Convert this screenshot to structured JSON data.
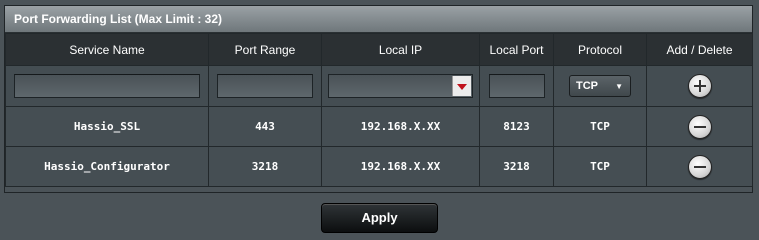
{
  "panel": {
    "title": "Port Forwarding List (Max Limit : 32)"
  },
  "table": {
    "headers": [
      "Service Name",
      "Port Range",
      "Local IP",
      "Local Port",
      "Protocol",
      "Add / Delete"
    ],
    "new_entry": {
      "service_name": "",
      "port_range": "",
      "local_ip": "",
      "local_port": "",
      "protocol": "TCP",
      "add_icon": "plus-circle-icon"
    },
    "rows": [
      {
        "service_name": "Hassio_SSL",
        "port_range": "443",
        "local_ip": "192.168.X.XX",
        "local_port": "8123",
        "protocol": "TCP",
        "delete_icon": "minus-circle-icon"
      },
      {
        "service_name": "Hassio_Configurator",
        "port_range": "3218",
        "local_ip": "192.168.X.XX",
        "local_port": "3218",
        "protocol": "TCP",
        "delete_icon": "minus-circle-icon"
      }
    ]
  },
  "apply_label": "Apply",
  "colors": {
    "accent": "#c0121c",
    "background": "#4b5358",
    "header": "#2b3033"
  }
}
